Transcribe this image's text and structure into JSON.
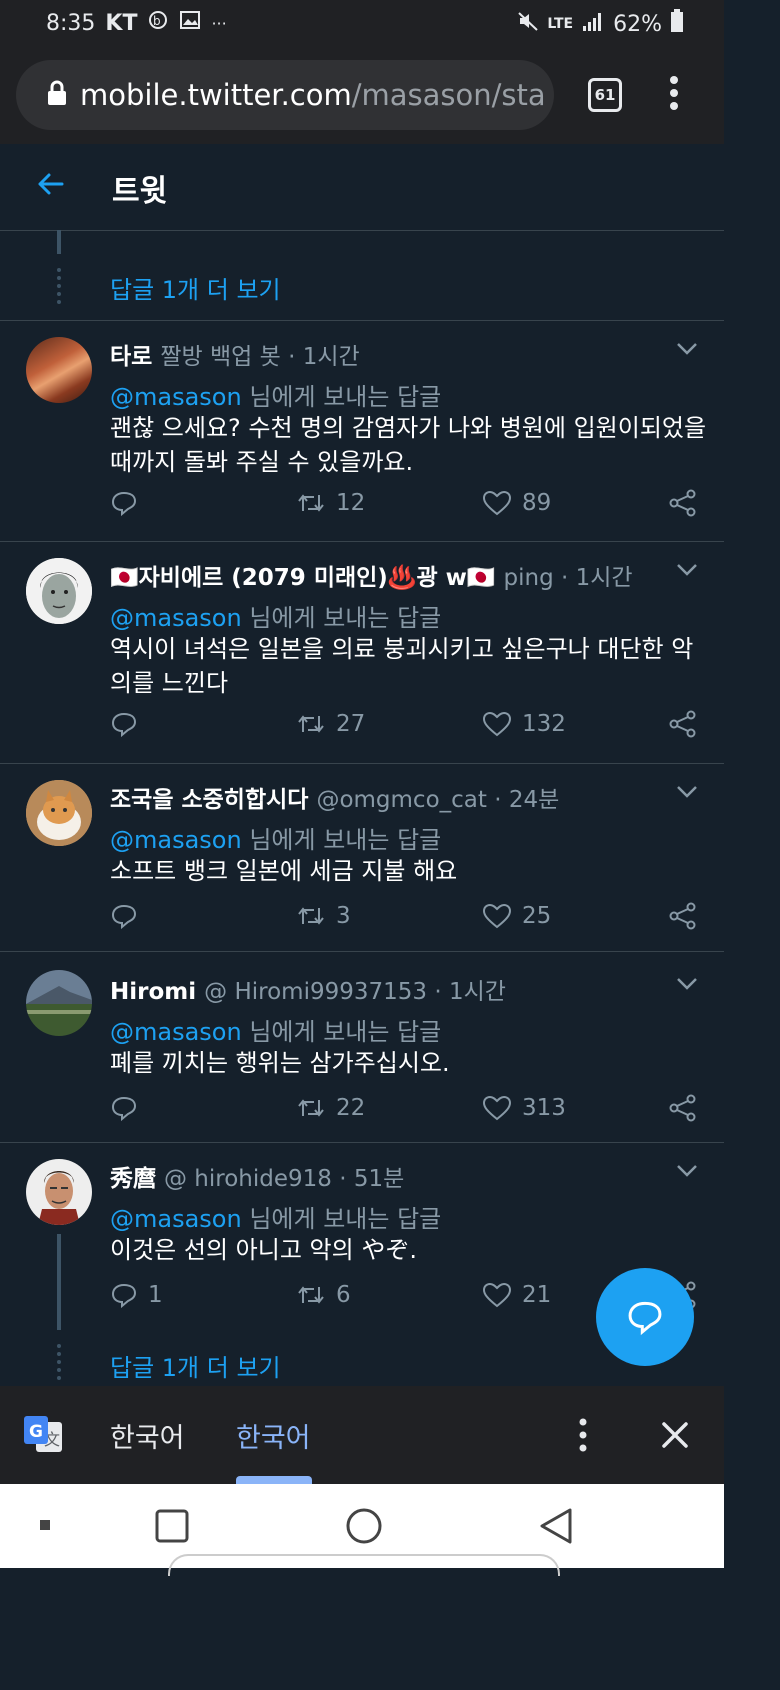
{
  "status_bar": {
    "time": "8:35",
    "carrier": "KT",
    "network": "LTE",
    "battery": "62%"
  },
  "browser": {
    "url_domain": "mobile.twitter.com",
    "url_path": "/masason/sta",
    "tab_count": "61"
  },
  "header": {
    "title": "트윗"
  },
  "show_more_top": "답글 1개 더 보기",
  "tweets": [
    {
      "name": "타로",
      "handle": "짤방 백업 봇",
      "time": "· 1시간",
      "reply_prefix": "@masason",
      "reply_suffix": " 님에게 보내는 답글",
      "text": "괜찮 으세요? 수천 명의 감염자가 나와 병원에 입원이되었을 때까지 돌봐 주실 수 있을까요.",
      "retweets": "12",
      "likes": "89",
      "replies": ""
    },
    {
      "name": "🇯🇵자비에르 (2079 미래인)♨️광 w🇯🇵",
      "handle": "ping",
      "time": "· 1시간",
      "reply_prefix": "@masason",
      "reply_suffix": " 님에게 보내는 답글",
      "text": "역시이 녀석은 일본을 의료 붕괴시키고 싶은구나 대단한 악의를 느낀다",
      "retweets": "27",
      "likes": "132",
      "replies": ""
    },
    {
      "name": "조국을 소중히합시다",
      "handle": "@omgmco_cat",
      "time": "· 24분",
      "reply_prefix": "@masason",
      "reply_suffix": " 님에게 보내는 답글",
      "text": "소프트 뱅크 일본에 세금 지불 해요",
      "retweets": "3",
      "likes": "25",
      "replies": ""
    },
    {
      "name": "Hiromi",
      "handle": "@ Hiromi99937153",
      "time": "· 1시간",
      "reply_prefix": "@masason",
      "reply_suffix": " 님에게 보내는 답글",
      "text": "폐를 끼치는 행위는 삼가주십시오.",
      "retweets": "22",
      "likes": "313",
      "replies": ""
    },
    {
      "name": "秀麿",
      "handle": "@ hirohide918",
      "time": "· 51분",
      "reply_prefix": "@masason",
      "reply_suffix": " 님에게 보내는 답글",
      "text": "이것은 선의 아니고 악의 やぞ.",
      "retweets": "6",
      "likes": "21",
      "replies": "1"
    }
  ],
  "show_more_bottom": "답글 1개 더 보기",
  "translate": {
    "source": "한국어",
    "target": "한국어"
  }
}
